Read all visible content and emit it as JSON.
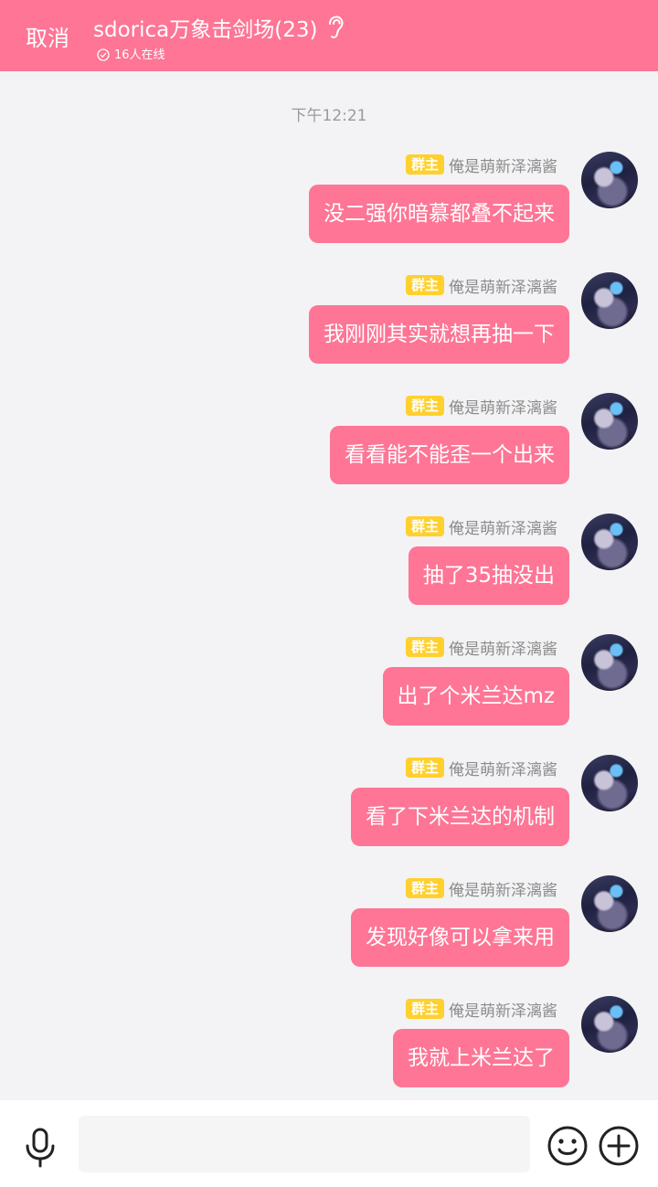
{
  "header": {
    "cancel_label": "取消",
    "title": "sdorica万象击剑场(23)",
    "online_text": "16人在线",
    "background_color": "#fe7595"
  },
  "chat": {
    "timestamp": "下午12:21",
    "messages": [
      {
        "badge": "群主",
        "sender": "俺是萌新泽漓酱",
        "text": "没二强你暗慕都叠不起来"
      },
      {
        "badge": "群主",
        "sender": "俺是萌新泽漓酱",
        "text": "我刚刚其实就想再抽一下"
      },
      {
        "badge": "群主",
        "sender": "俺是萌新泽漓酱",
        "text": "看看能不能歪一个出来"
      },
      {
        "badge": "群主",
        "sender": "俺是萌新泽漓酱",
        "text": "抽了35抽没出"
      },
      {
        "badge": "群主",
        "sender": "俺是萌新泽漓酱",
        "text": "出了个米兰达mz"
      },
      {
        "badge": "群主",
        "sender": "俺是萌新泽漓酱",
        "text": "看了下米兰达的机制"
      },
      {
        "badge": "群主",
        "sender": "俺是萌新泽漓酱",
        "text": "发现好像可以拿来用"
      },
      {
        "badge": "群主",
        "sender": "俺是萌新泽漓酱",
        "text": "我就上米兰达了"
      }
    ],
    "bubble_color": "#fe7595",
    "badge_color": "#ffd02e"
  },
  "input_bar": {
    "input_value": "",
    "icons": [
      "microphone-icon",
      "emoji-icon",
      "plus-icon"
    ]
  }
}
